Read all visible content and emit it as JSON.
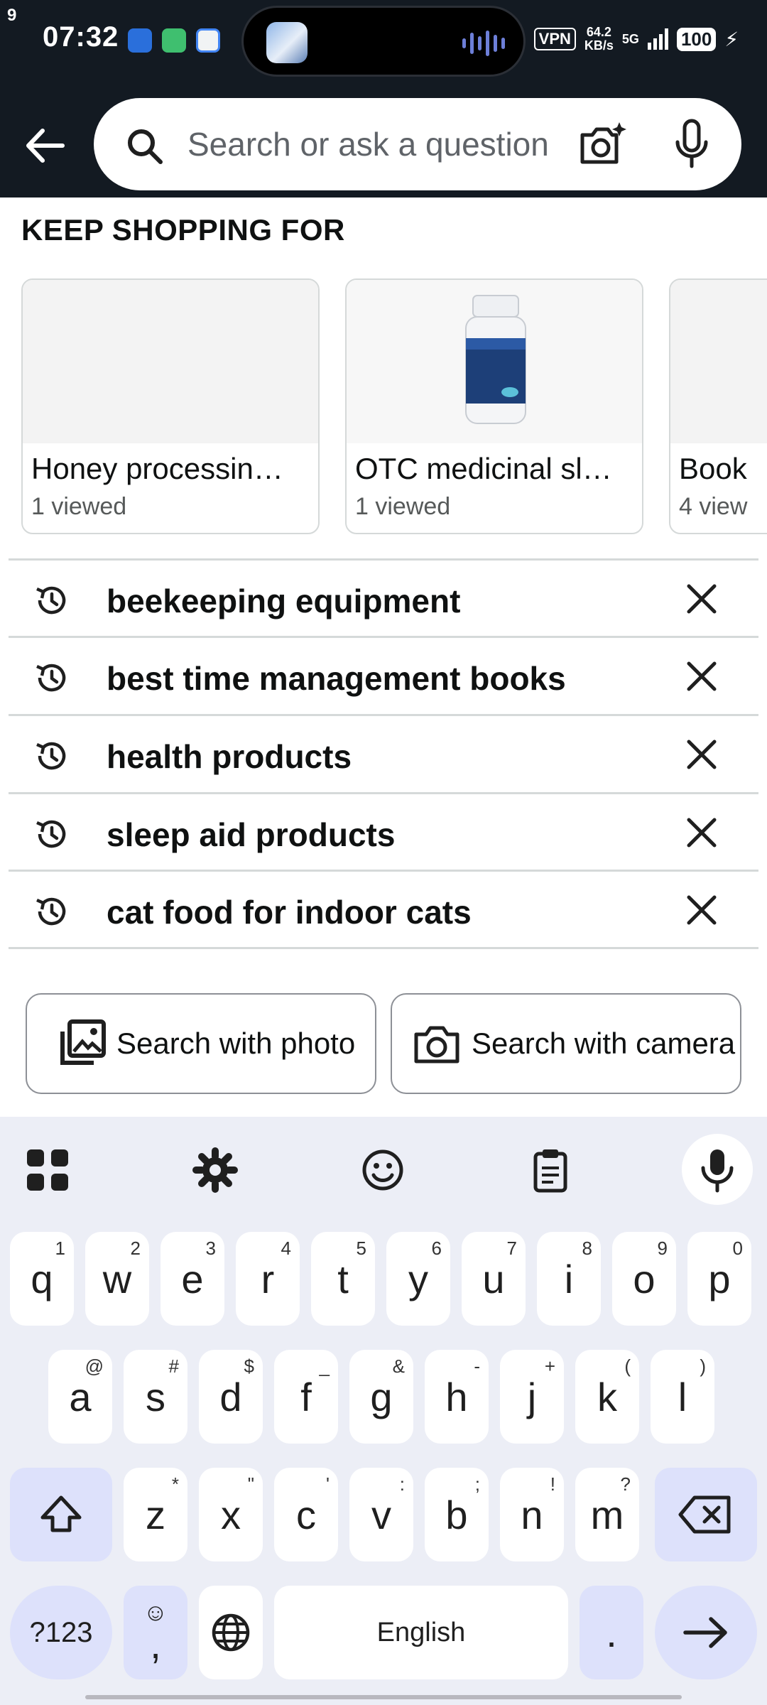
{
  "status_bar": {
    "corner": "9",
    "time": "07:32",
    "vpn": "VPN",
    "net_speed_value": "64.2",
    "net_speed_unit": "KB/s",
    "network": "5G",
    "battery": "100"
  },
  "search": {
    "placeholder": "Search or ask a question"
  },
  "keep_shopping": {
    "title": "KEEP SHOPPING FOR",
    "cards": [
      {
        "title": "Honey processin…",
        "sub": "1 viewed"
      },
      {
        "title": "OTC medicinal sl…",
        "sub": "1 viewed"
      },
      {
        "title": "Book",
        "sub": "4 view"
      }
    ]
  },
  "history": [
    {
      "text": "beekeeping equipment"
    },
    {
      "text": "best time management books"
    },
    {
      "text": "health products"
    },
    {
      "text": "sleep aid products"
    },
    {
      "text": "cat food for indoor cats"
    }
  ],
  "buttons": {
    "photo": "Search with photo",
    "camera": "Search with camera"
  },
  "keyboard": {
    "row1": [
      {
        "k": "q",
        "s": "1"
      },
      {
        "k": "w",
        "s": "2"
      },
      {
        "k": "e",
        "s": "3"
      },
      {
        "k": "r",
        "s": "4"
      },
      {
        "k": "t",
        "s": "5"
      },
      {
        "k": "y",
        "s": "6"
      },
      {
        "k": "u",
        "s": "7"
      },
      {
        "k": "i",
        "s": "8"
      },
      {
        "k": "o",
        "s": "9"
      },
      {
        "k": "p",
        "s": "0"
      }
    ],
    "row2": [
      {
        "k": "a",
        "s": "@"
      },
      {
        "k": "s",
        "s": "#"
      },
      {
        "k": "d",
        "s": "$"
      },
      {
        "k": "f",
        "s": "_"
      },
      {
        "k": "g",
        "s": "&"
      },
      {
        "k": "h",
        "s": "-"
      },
      {
        "k": "j",
        "s": "+"
      },
      {
        "k": "k",
        "s": "("
      },
      {
        "k": "l",
        "s": ")"
      }
    ],
    "row3": [
      {
        "k": "z",
        "s": "*"
      },
      {
        "k": "x",
        "s": "\""
      },
      {
        "k": "c",
        "s": "'"
      },
      {
        "k": "v",
        "s": ":"
      },
      {
        "k": "b",
        "s": ";"
      },
      {
        "k": "n",
        "s": "!"
      },
      {
        "k": "m",
        "s": "?"
      }
    ],
    "symbols_label": "?123",
    "comma_label": ",",
    "space_label": "English",
    "period_label": "."
  }
}
